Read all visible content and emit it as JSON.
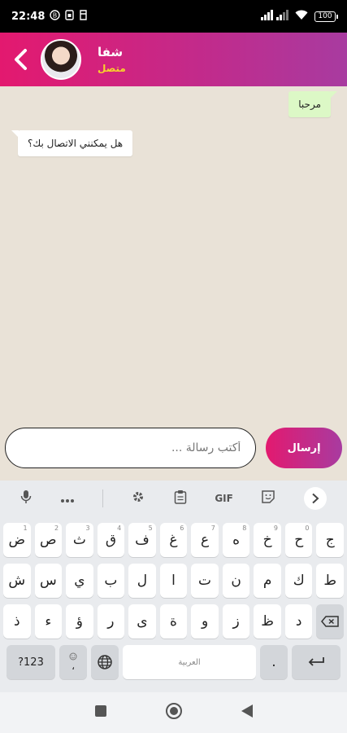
{
  "status_bar": {
    "time": "22:48",
    "left_icons": [
      "notification-icon",
      "sim-icon",
      "storage-icon"
    ],
    "battery": "100"
  },
  "header": {
    "contact_name": "شفا",
    "contact_status": "متصل",
    "back_icon": "chevron-left-icon"
  },
  "messages": [
    {
      "direction": "out",
      "text": "مرحبا"
    },
    {
      "direction": "in",
      "text": "هل يمكنني الاتصال بك؟"
    }
  ],
  "composer": {
    "placeholder": "أكتب رسالة ...",
    "send_label": "إرسال"
  },
  "keyboard": {
    "toolbar": {
      "gif_label": "GIF"
    },
    "row1": [
      {
        "k": "ض",
        "s": "1"
      },
      {
        "k": "ص",
        "s": "2"
      },
      {
        "k": "ث",
        "s": "3"
      },
      {
        "k": "ق",
        "s": "4"
      },
      {
        "k": "ف",
        "s": "5"
      },
      {
        "k": "غ",
        "s": "6"
      },
      {
        "k": "ع",
        "s": "7"
      },
      {
        "k": "ه",
        "s": "8"
      },
      {
        "k": "خ",
        "s": "9"
      },
      {
        "k": "ح",
        "s": "0"
      },
      {
        "k": "ج",
        "s": ""
      }
    ],
    "row2": [
      "ش",
      "س",
      "ي",
      "ب",
      "ل",
      "ا",
      "ت",
      "ن",
      "م",
      "ك",
      "ط"
    ],
    "row3": [
      "ذ",
      "ء",
      "ؤ",
      "ر",
      "ى",
      "ة",
      "و",
      "ز",
      "ظ",
      "د"
    ],
    "num_label": "?123",
    "comma": "،",
    "space_label": "العربية",
    "period": "."
  },
  "colors": {
    "header_start": "#e3196f",
    "header_end": "#a83ba0",
    "status_text": "#f7d32b",
    "outgoing_bubble": "#dcf8c6",
    "chat_bg": "#e9e2d7"
  }
}
